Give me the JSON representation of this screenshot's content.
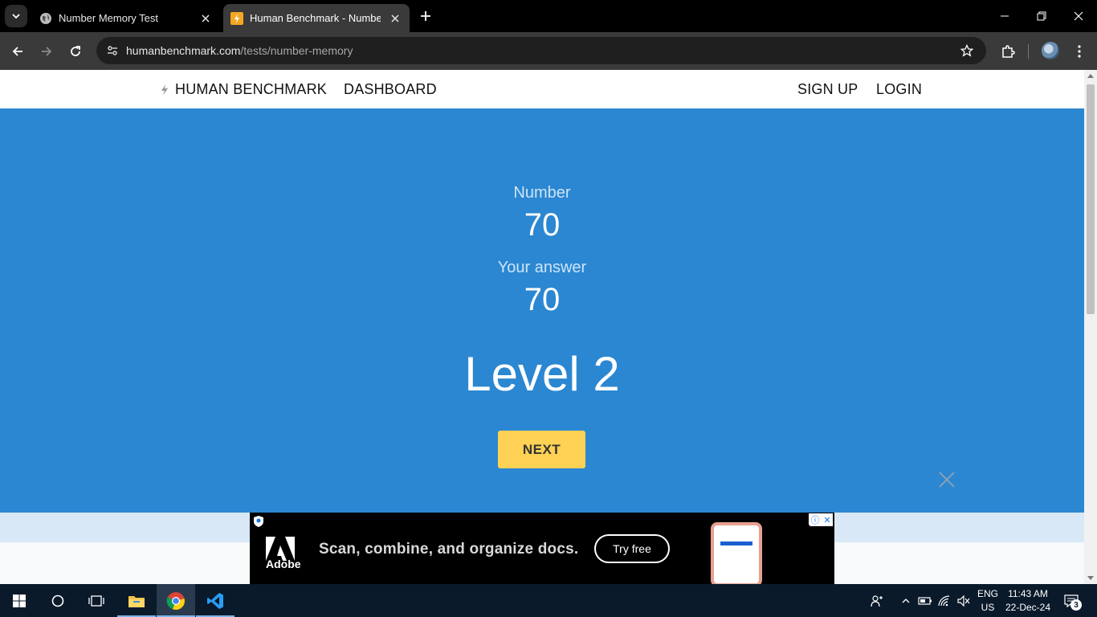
{
  "browser": {
    "tabs": [
      {
        "title": "Number Memory Test",
        "active": false
      },
      {
        "title": "Human Benchmark - Number Memory",
        "active": true
      }
    ],
    "url_host": "humanbenchmark.com",
    "url_path": "/tests/number-memory"
  },
  "site": {
    "nav": {
      "brand": "HUMAN BENCHMARK",
      "dashboard": "DASHBOARD",
      "signup": "SIGN UP",
      "login": "LOGIN"
    },
    "test": {
      "number_label": "Number",
      "number_value": "70",
      "answer_label": "Your answer",
      "answer_value": "70",
      "level_text": "Level 2",
      "next_label": "NEXT"
    },
    "colors": {
      "hero_bg": "#2b87d1",
      "button_bg": "#ffd154"
    }
  },
  "ad": {
    "brand": "Adobe",
    "headline": "Scan, combine, and organize docs.",
    "cta": "Try free"
  },
  "taskbar": {
    "lang_top": "ENG",
    "lang_bottom": "US",
    "time": "11:43 AM",
    "date": "22-Dec-24",
    "notifications": "3"
  }
}
